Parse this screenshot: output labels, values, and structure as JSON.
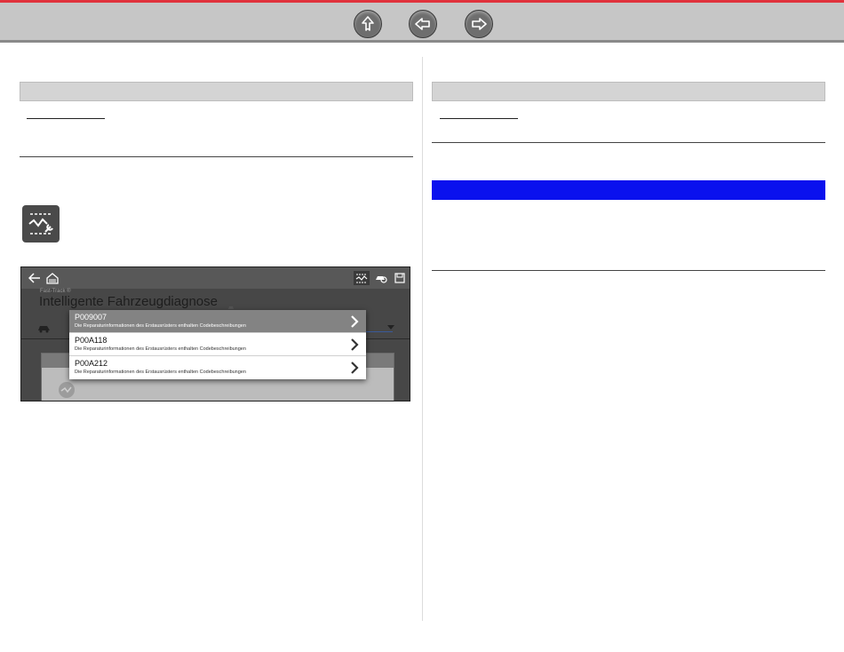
{
  "toolbar": {
    "buttons": [
      {
        "name": "up-arrow-icon"
      },
      {
        "name": "left-arrow-icon"
      },
      {
        "name": "right-arrow-icon"
      }
    ]
  },
  "device_screen": {
    "app_label": "Fast-Track ®",
    "title": "Intelligente Fahrzeugdiagnose",
    "codes": [
      {
        "code": "P009007",
        "description": "Die Reparaturinformationen des Erstausrüsters enthalten Codebeschreibungen",
        "selected": true
      },
      {
        "code": "P00A118",
        "description": "Die Reparaturinformationen des Erstausrüsters enthalten Codebeschreibungen",
        "selected": false
      },
      {
        "code": "P00A212",
        "description": "Die Reparaturinformationen des Erstausrüsters enthalten Codebeschreibungen",
        "selected": false
      }
    ]
  },
  "colors": {
    "accent_red": "#e0323c",
    "highlight_blue": "#0a11ee",
    "selected_row": "#838383"
  }
}
